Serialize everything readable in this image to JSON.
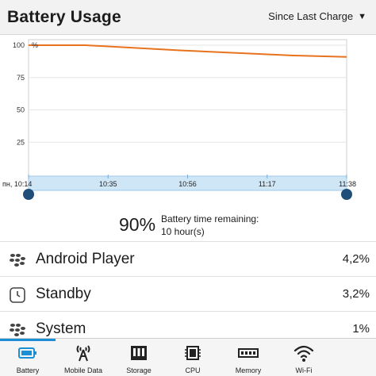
{
  "header": {
    "title": "Battery Usage",
    "range_label": "Since Last Charge"
  },
  "chart_data": {
    "type": "line",
    "y_ticks": [
      "100",
      "75",
      "50",
      "25"
    ],
    "y_unit": "%",
    "ylim": [
      0,
      100
    ],
    "x_labels": [
      "пн, 10:14",
      "10:35",
      "10:56",
      "11:17",
      "11:38"
    ],
    "x_minutes": [
      0,
      21,
      42,
      63,
      84
    ],
    "series": [
      {
        "color": "#e8731e",
        "x": [
          0,
          8,
          15,
          40,
          70,
          84
        ],
        "values": [
          100,
          100,
          100,
          96,
          92,
          91
        ]
      }
    ],
    "selection": {
      "from": "пн, 10:14",
      "to": "11:38"
    }
  },
  "summary": {
    "percent": "90%",
    "label": "Battery time remaining:",
    "value": "10 hour(s)"
  },
  "apps": [
    {
      "icon": "blackberry-icon",
      "name": "Android Player",
      "value": "4,2%"
    },
    {
      "icon": "standby-clock-icon",
      "name": "Standby",
      "value": "3,2%"
    },
    {
      "icon": "blackberry-icon",
      "name": "System",
      "value": "1%"
    }
  ],
  "tabs": [
    {
      "id": "battery",
      "label": "Battery",
      "icon": "battery-icon",
      "active": true
    },
    {
      "id": "mobile-data",
      "label": "Mobile Data",
      "icon": "antenna-icon"
    },
    {
      "id": "storage",
      "label": "Storage",
      "icon": "storage-icon"
    },
    {
      "id": "cpu",
      "label": "CPU",
      "icon": "cpu-icon"
    },
    {
      "id": "memory",
      "label": "Memory",
      "icon": "memory-icon"
    },
    {
      "id": "wifi",
      "label": "Wi-Fi",
      "icon": "wifi-icon"
    }
  ],
  "colors": {
    "accent": "#1a8fd6",
    "line": "#e8731e",
    "handle": "#1f4e79",
    "selection": "#cfe6f6"
  }
}
